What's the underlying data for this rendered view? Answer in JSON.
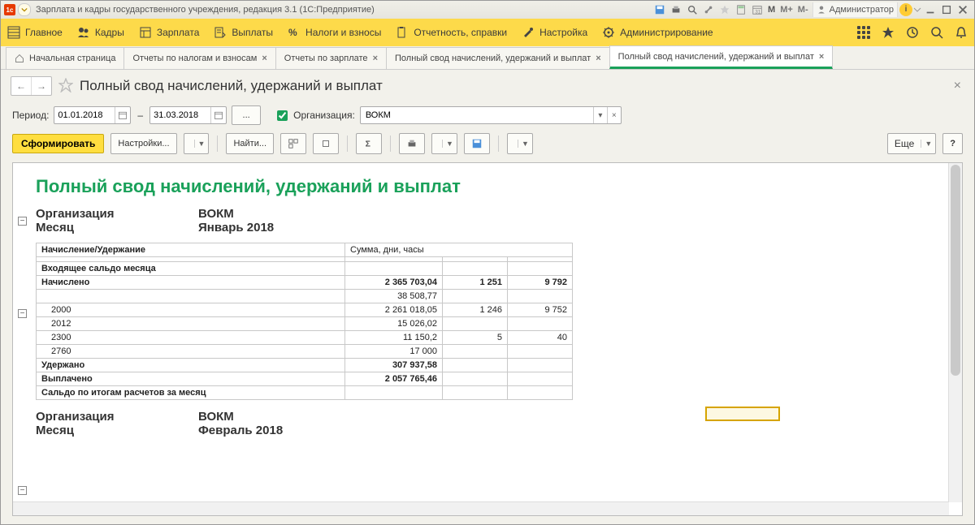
{
  "titlebar": {
    "title": "Зарплата и кадры государственного учреждения, редакция 3.1  (1С:Предприятие)",
    "m_group": [
      "M",
      "M+",
      "M-"
    ],
    "user": "Администратор"
  },
  "mainnav": {
    "items": [
      "Главное",
      "Кадры",
      "Зарплата",
      "Выплаты",
      "Налоги и взносы",
      "Отчетность, справки",
      "Настройка",
      "Администрирование"
    ]
  },
  "tabs": [
    {
      "label": "Начальная страница",
      "home": true,
      "closable": false
    },
    {
      "label": "Отчеты по налогам и взносам",
      "closable": true
    },
    {
      "label": "Отчеты по зарплате",
      "closable": true
    },
    {
      "label": "Полный свод начислений, удержаний и выплат",
      "closable": true
    },
    {
      "label": "Полный свод начислений, удержаний и выплат",
      "closable": true,
      "active": true
    }
  ],
  "page_title": "Полный свод начислений, удержаний и выплат",
  "filter": {
    "period_label": "Период:",
    "from": "01.01.2018",
    "to": "31.03.2018",
    "more": "...",
    "org_label": "Организация:",
    "org_value": "ВОКМ"
  },
  "toolbar": {
    "generate": "Сформировать",
    "settings": "Настройки...",
    "find": "Найти...",
    "more": "Еще"
  },
  "report": {
    "title": "Полный свод начислений, удержаний и выплат",
    "block1": {
      "org_label": "Организация",
      "org": "ВОКМ",
      "month_label": "Месяц",
      "month": "Январь 2018"
    },
    "headers": {
      "col1": "Начисление/Удержание",
      "col2": "Сумма, дни, часы"
    },
    "rows": [
      {
        "label": "Входящее сальдо месяца",
        "bold": true,
        "c1": "",
        "c2": "",
        "c3": ""
      },
      {
        "label": "Начислено",
        "bold": true,
        "c1": "2 365 703,04",
        "c2": "1 251",
        "c3": "9 792"
      },
      {
        "label": "",
        "indent": 1,
        "c1": "38 508,77",
        "c2": "",
        "c3": ""
      },
      {
        "label": "2000",
        "indent": 1,
        "c1": "2 261 018,05",
        "c2": "1 246",
        "c3": "9 752"
      },
      {
        "label": "2012",
        "indent": 1,
        "c1": "15 026,02",
        "c2": "",
        "c3": ""
      },
      {
        "label": "2300",
        "indent": 1,
        "c1": "11 150,2",
        "c2": "5",
        "c3": "40"
      },
      {
        "label": "2760",
        "indent": 1,
        "c1": "17 000",
        "c2": "",
        "c3": ""
      },
      {
        "label": "Удержано",
        "bold": true,
        "c1": "307 937,58",
        "c2": "",
        "c3": ""
      },
      {
        "label": "Выплачено",
        "bold": true,
        "c1": "2 057 765,46",
        "c2": "",
        "c3": ""
      },
      {
        "label": "Сальдо по итогам расчетов за месяц",
        "bold": true,
        "c1": "",
        "c2": "",
        "c3": ""
      }
    ],
    "block2": {
      "org_label": "Организация",
      "org": "ВОКМ",
      "month_label": "Месяц",
      "month": "Февраль 2018"
    }
  },
  "help": "?"
}
